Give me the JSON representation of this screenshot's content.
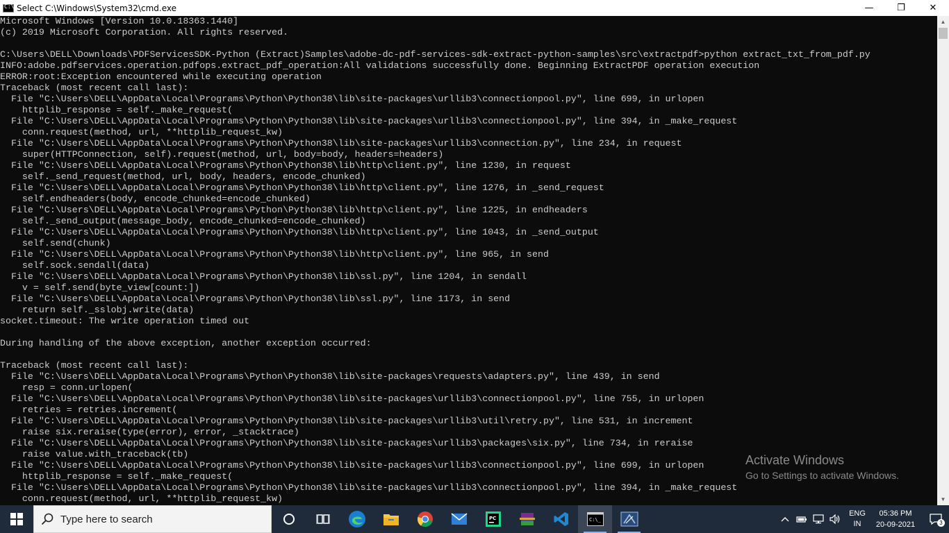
{
  "window": {
    "title": "Select C:\\Windows\\System32\\cmd.exe",
    "minimize_glyph": "—",
    "maximize_glyph": "❐",
    "close_glyph": "✕"
  },
  "console_lines": [
    "Microsoft Windows [Version 10.0.18363.1440]",
    "(c) 2019 Microsoft Corporation. All rights reserved.",
    "",
    "C:\\Users\\DELL\\Downloads\\PDFServicesSDK-Python (Extract)Samples\\adobe-dc-pdf-services-sdk-extract-python-samples\\src\\extractpdf>python extract_txt_from_pdf.py",
    "INFO:adobe.pdfservices.operation.pdfops.extract_pdf_operation:All validations successfully done. Beginning ExtractPDF operation execution",
    "ERROR:root:Exception encountered while executing operation",
    "Traceback (most recent call last):",
    "  File \"C:\\Users\\DELL\\AppData\\Local\\Programs\\Python\\Python38\\lib\\site-packages\\urllib3\\connectionpool.py\", line 699, in urlopen",
    "    httplib_response = self._make_request(",
    "  File \"C:\\Users\\DELL\\AppData\\Local\\Programs\\Python\\Python38\\lib\\site-packages\\urllib3\\connectionpool.py\", line 394, in _make_request",
    "    conn.request(method, url, **httplib_request_kw)",
    "  File \"C:\\Users\\DELL\\AppData\\Local\\Programs\\Python\\Python38\\lib\\site-packages\\urllib3\\connection.py\", line 234, in request",
    "    super(HTTPConnection, self).request(method, url, body=body, headers=headers)",
    "  File \"C:\\Users\\DELL\\AppData\\Local\\Programs\\Python\\Python38\\lib\\http\\client.py\", line 1230, in request",
    "    self._send_request(method, url, body, headers, encode_chunked)",
    "  File \"C:\\Users\\DELL\\AppData\\Local\\Programs\\Python\\Python38\\lib\\http\\client.py\", line 1276, in _send_request",
    "    self.endheaders(body, encode_chunked=encode_chunked)",
    "  File \"C:\\Users\\DELL\\AppData\\Local\\Programs\\Python\\Python38\\lib\\http\\client.py\", line 1225, in endheaders",
    "    self._send_output(message_body, encode_chunked=encode_chunked)",
    "  File \"C:\\Users\\DELL\\AppData\\Local\\Programs\\Python\\Python38\\lib\\http\\client.py\", line 1043, in _send_output",
    "    self.send(chunk)",
    "  File \"C:\\Users\\DELL\\AppData\\Local\\Programs\\Python\\Python38\\lib\\http\\client.py\", line 965, in send",
    "    self.sock.sendall(data)",
    "  File \"C:\\Users\\DELL\\AppData\\Local\\Programs\\Python\\Python38\\lib\\ssl.py\", line 1204, in sendall",
    "    v = self.send(byte_view[count:])",
    "  File \"C:\\Users\\DELL\\AppData\\Local\\Programs\\Python\\Python38\\lib\\ssl.py\", line 1173, in send",
    "    return self._sslobj.write(data)",
    "socket.timeout: The write operation timed out",
    "",
    "During handling of the above exception, another exception occurred:",
    "",
    "Traceback (most recent call last):",
    "  File \"C:\\Users\\DELL\\AppData\\Local\\Programs\\Python\\Python38\\lib\\site-packages\\requests\\adapters.py\", line 439, in send",
    "    resp = conn.urlopen(",
    "  File \"C:\\Users\\DELL\\AppData\\Local\\Programs\\Python\\Python38\\lib\\site-packages\\urllib3\\connectionpool.py\", line 755, in urlopen",
    "    retries = retries.increment(",
    "  File \"C:\\Users\\DELL\\AppData\\Local\\Programs\\Python\\Python38\\lib\\site-packages\\urllib3\\util\\retry.py\", line 531, in increment",
    "    raise six.reraise(type(error), error, _stacktrace)",
    "  File \"C:\\Users\\DELL\\AppData\\Local\\Programs\\Python\\Python38\\lib\\site-packages\\urllib3\\packages\\six.py\", line 734, in reraise",
    "    raise value.with_traceback(tb)",
    "  File \"C:\\Users\\DELL\\AppData\\Local\\Programs\\Python\\Python38\\lib\\site-packages\\urllib3\\connectionpool.py\", line 699, in urlopen",
    "    httplib_response = self._make_request(",
    "  File \"C:\\Users\\DELL\\AppData\\Local\\Programs\\Python\\Python38\\lib\\site-packages\\urllib3\\connectionpool.py\", line 394, in _make_request",
    "    conn.request(method, url, **httplib_request_kw)"
  ],
  "watermark": {
    "title": "Activate Windows",
    "subtitle": "Go to Settings to activate Windows."
  },
  "taskbar": {
    "search_placeholder": "Type here to search",
    "language": {
      "line1": "ENG",
      "line2": "IN"
    },
    "clock": {
      "time": "05:36 PM",
      "date": "20-09-2021"
    },
    "notification_count": "3",
    "apps": [
      {
        "name": "cortana-icon"
      },
      {
        "name": "task-view-icon"
      },
      {
        "name": "edge-icon"
      },
      {
        "name": "file-explorer-icon"
      },
      {
        "name": "chrome-icon"
      },
      {
        "name": "mail-icon"
      },
      {
        "name": "pycharm-icon"
      },
      {
        "name": "winrar-icon"
      },
      {
        "name": "vscode-icon"
      },
      {
        "name": "cmd-icon",
        "state": "active"
      },
      {
        "name": "snipping-tool-icon",
        "state": "running"
      }
    ]
  },
  "colors": {
    "console_bg": "#0c0c0c",
    "console_text": "#cccccc",
    "taskbar_bg": "#1f2b3a"
  }
}
